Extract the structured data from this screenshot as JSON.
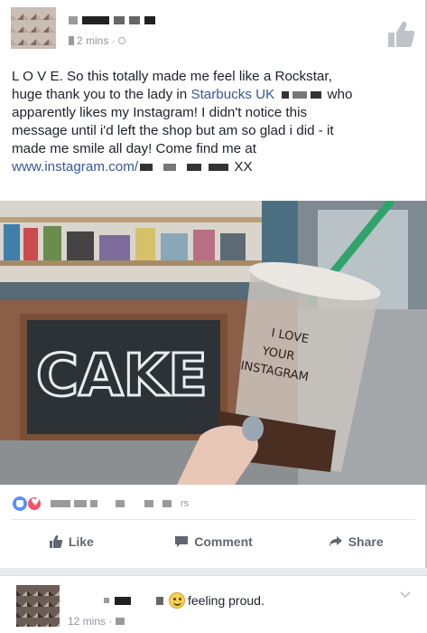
{
  "post": {
    "timestamp": "2 mins ·",
    "text_lines": [
      "L O V E. So this totally made me feel like a Rockstar,",
      "huge thank you to the lady in ",
      "apparently likes my Instagram! I didn't notice this",
      "message until i'd left the shop but am so glad i did - it",
      "made me smile all day! Come find me at"
    ],
    "starbucks_link": "Starbucks UK",
    "who": "who",
    "instagram_link": "www.instagram.com/",
    "sign_off": "XX",
    "photo": {
      "sign_text": "CAKE",
      "cup_text": [
        "I LOVE",
        "YOUR",
        "INSTAGRAM"
      ]
    }
  },
  "reactions": {
    "count_suffix": "rs"
  },
  "actions": {
    "like": "Like",
    "comment": "Comment",
    "share": "Share"
  },
  "comment": {
    "feeling": "feeling proud.",
    "timestamp": "12 mins ·"
  },
  "colors": {
    "link": "#365899",
    "action_text": "#616770",
    "meta_text": "#90949c",
    "straw": "#2fa36b"
  },
  "icons": [
    "like-icon",
    "comment-icon",
    "share-icon",
    "globe-icon",
    "thumbs-up-icon",
    "smile-emoji-icon",
    "chevron-down-icon"
  ]
}
